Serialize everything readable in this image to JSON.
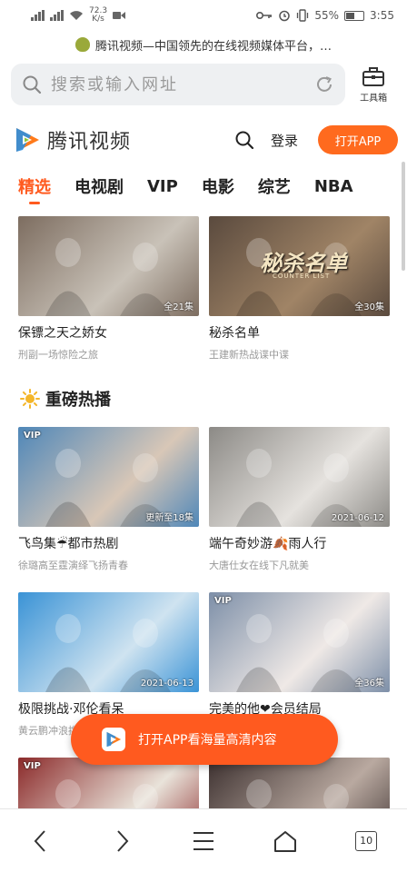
{
  "status_bar": {
    "net_speed_value": "72.3",
    "net_speed_unit": "K/s",
    "battery_percent": "55%",
    "battery_level": 0.55,
    "time": "3:55"
  },
  "notice": {
    "text": "腾讯视频—中国领先的在线视频媒体平台，…"
  },
  "url_bar": {
    "placeholder": "搜索或输入网址",
    "toolbox_label": "工具箱"
  },
  "site_header": {
    "logo_text": "腾讯视频",
    "login_label": "登录",
    "open_app_label": "打开APP"
  },
  "tabs": [
    {
      "label": "精选",
      "active": true
    },
    {
      "label": "电视剧",
      "active": false
    },
    {
      "label": "VIP",
      "active": false
    },
    {
      "label": "电影",
      "active": false
    },
    {
      "label": "综艺",
      "active": false
    },
    {
      "label": "NBA",
      "active": false
    }
  ],
  "top_row": [
    {
      "title": "保镖之天之娇女",
      "subtitle": "刑副一场惊险之旅",
      "badge": "全21集",
      "color_a": "#7d6d60",
      "color_b": "#c9c2b8"
    },
    {
      "title": "秘杀名单",
      "subtitle": "王建新热战谍中谍",
      "badge": "全30集",
      "color_a": "#5a4a3e",
      "color_b": "#a08466",
      "poster_text": "秘杀名单",
      "poster_sub": "COUNTER LIST"
    }
  ],
  "section": {
    "title": "重磅热播"
  },
  "hot_rows": [
    [
      {
        "title": "飞鸟集☔都市热剧",
        "subtitle": "徐璐高至霆演绎飞扬青春",
        "badge": "更新至18集",
        "vip": "VIP",
        "color_a": "#4f87b8",
        "color_b": "#d8c7b7"
      },
      {
        "title": "端午奇妙游🍂雨人行",
        "subtitle": "大唐仕女在线下凡就美",
        "badge": "2021-06-12",
        "color_a": "#8c8a86",
        "color_b": "#e5e2de"
      }
    ],
    [
      {
        "title": "极限挑战·邓伦看呆",
        "subtitle": "黄云鹏冲浪挑战黄慈昕表",
        "badge": "2021-06-13",
        "vip": "",
        "color_a": "#3a93d6",
        "color_b": "#cfe3f0"
      },
      {
        "title": "完美的他❤会员结局",
        "subtitle": "虞书欣王作恋爱温甜宠进",
        "badge": "全36集",
        "vip": "VIP",
        "color_a": "#7d8fa8",
        "color_b": "#efe9e6"
      }
    ],
    [
      {
        "title": "",
        "subtitle": "",
        "badge": "",
        "vip": "VIP",
        "color_a": "#8b2a2a",
        "color_b": "#e9e3da"
      },
      {
        "title": "",
        "subtitle": "",
        "badge": "",
        "vip": "",
        "color_a": "#3d3130",
        "color_b": "#b9a9a0"
      }
    ]
  ],
  "float_button": {
    "label": "打开APP看海量高清内容"
  },
  "bottom_nav": {
    "tab_count": "10"
  },
  "colors": {
    "accent": "#ff5a1f",
    "open_app_bg": "#ff6a1e",
    "logo_orange": "#ff7a1a",
    "logo_blue": "#2c8fe0"
  }
}
